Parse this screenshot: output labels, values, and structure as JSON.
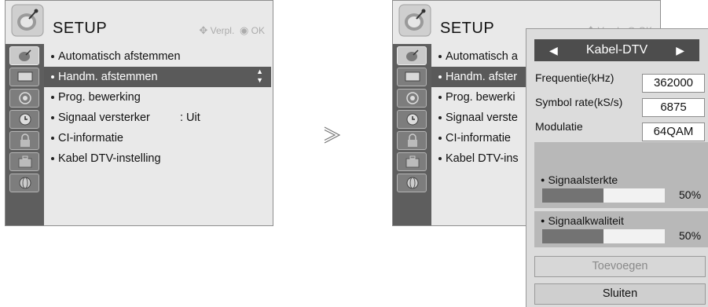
{
  "setup_menu": {
    "title": "SETUP",
    "hint_move": "Verpl.",
    "hint_ok": "OK",
    "items": [
      {
        "label": "Automatisch afstemmen"
      },
      {
        "label": "Handm. afstemmen"
      },
      {
        "label": "Prog. bewerking"
      },
      {
        "label": "Signaal versterker",
        "value": ": Uit"
      },
      {
        "label": "CI-informatie"
      },
      {
        "label": "Kabel DTV-instelling"
      }
    ],
    "right_items": [
      {
        "label": "Automatisch a"
      },
      {
        "label": "Handm. afster"
      },
      {
        "label": "Prog. bewerki"
      },
      {
        "label": "Signaal verste"
      },
      {
        "label": "CI-informatie"
      },
      {
        "label": "Kabel DTV-ins"
      }
    ],
    "sidebar_icons": [
      "satellite-dish-icon",
      "tv-screen-icon",
      "speaker-icon",
      "clock-icon",
      "padlock-icon",
      "toolbox-icon",
      "globe-icon"
    ]
  },
  "transition_arrow": ">",
  "popup": {
    "channel_type": "Kabel-DTV",
    "rows": [
      {
        "label": "Frequentie(kHz)",
        "value": "362000"
      },
      {
        "label": "Symbol rate(kS/s)",
        "value": "6875"
      },
      {
        "label": "Modulatie",
        "value": "64QAM"
      }
    ],
    "signal_strength": {
      "label": "Signaalsterkte",
      "percent_text": "50%",
      "level": 0.5
    },
    "signal_quality": {
      "label": "Signaalkwaliteit",
      "percent_text": "50%",
      "level": 0.5
    },
    "add_button": "Toevoegen",
    "close_button": "Sluiten"
  },
  "colors": {
    "menu_bg": "#e9e9e9",
    "sidebar": "#5e5e5e",
    "selection": "#5a5a5a",
    "channel_bar": "#4d4d4d",
    "signal_fill": "#737373"
  }
}
